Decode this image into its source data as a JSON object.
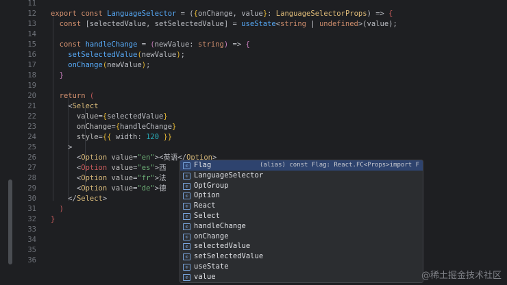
{
  "editor": {
    "lines": [
      {
        "n": "11",
        "tokens": []
      },
      {
        "n": "12",
        "tokens": [
          {
            "t": "export const ",
            "c": "kw"
          },
          {
            "t": "LanguageSelector",
            "c": "fn"
          },
          {
            "t": " = (",
            "c": "pl"
          },
          {
            "t": "{",
            "c": "br1"
          },
          {
            "t": "onChange",
            "c": "pl"
          },
          {
            "t": ", ",
            "c": "pl"
          },
          {
            "t": "value",
            "c": "pl"
          },
          {
            "t": "}",
            "c": "br1"
          },
          {
            "t": ": ",
            "c": "pl"
          },
          {
            "t": "LanguageSelectorProps",
            "c": "ty"
          },
          {
            "t": ") => ",
            "c": "pl"
          },
          {
            "t": "{",
            "c": "br2"
          }
        ]
      },
      {
        "n": "13",
        "tokens": [
          {
            "t": "  const ",
            "c": "kw"
          },
          {
            "t": "[selectedValue, setSelectedValue]",
            "c": "pl"
          },
          {
            "t": " = ",
            "c": "pl"
          },
          {
            "t": "useState",
            "c": "fn"
          },
          {
            "t": "<",
            "c": "pl"
          },
          {
            "t": "string",
            "c": "kw"
          },
          {
            "t": " | ",
            "c": "pl"
          },
          {
            "t": "undefined",
            "c": "kw"
          },
          {
            "t": ">(value);",
            "c": "pl"
          }
        ]
      },
      {
        "n": "14",
        "tokens": []
      },
      {
        "n": "15",
        "tokens": [
          {
            "t": "  const ",
            "c": "kw"
          },
          {
            "t": "handleChange",
            "c": "fn"
          },
          {
            "t": " = ",
            "c": "pl"
          },
          {
            "t": "(",
            "c": "br3"
          },
          {
            "t": "newValue: ",
            "c": "pl"
          },
          {
            "t": "string",
            "c": "kw"
          },
          {
            "t": ")",
            "c": "br3"
          },
          {
            "t": " => ",
            "c": "pl"
          },
          {
            "t": "{",
            "c": "br3"
          }
        ]
      },
      {
        "n": "16",
        "tokens": [
          {
            "t": "    setSelectedValue",
            "c": "fn"
          },
          {
            "t": "(",
            "c": "br1"
          },
          {
            "t": "newValue",
            "c": "pl"
          },
          {
            "t": ")",
            "c": "br1"
          },
          {
            "t": ";",
            "c": "pl"
          }
        ]
      },
      {
        "n": "17",
        "tokens": [
          {
            "t": "    onChange",
            "c": "fn"
          },
          {
            "t": "(",
            "c": "br1"
          },
          {
            "t": "newValue",
            "c": "pl"
          },
          {
            "t": ")",
            "c": "br1"
          },
          {
            "t": ";",
            "c": "pl"
          }
        ]
      },
      {
        "n": "18",
        "tokens": [
          {
            "t": "  }",
            "c": "br3"
          }
        ]
      },
      {
        "n": "19",
        "tokens": []
      },
      {
        "n": "20",
        "tokens": [
          {
            "t": "  return ",
            "c": "kw"
          },
          {
            "t": "(",
            "c": "br2"
          }
        ]
      },
      {
        "n": "21",
        "tokens": [
          {
            "t": "    <",
            "c": "pl"
          },
          {
            "t": "Select",
            "c": "tag"
          }
        ]
      },
      {
        "n": "22",
        "tokens": [
          {
            "t": "      value",
            "c": "at"
          },
          {
            "t": "=",
            "c": "pl"
          },
          {
            "t": "{",
            "c": "br1"
          },
          {
            "t": "selectedValue",
            "c": "pl"
          },
          {
            "t": "}",
            "c": "br1"
          }
        ]
      },
      {
        "n": "23",
        "tokens": [
          {
            "t": "      onChange",
            "c": "at"
          },
          {
            "t": "=",
            "c": "pl"
          },
          {
            "t": "{",
            "c": "br1"
          },
          {
            "t": "handleChange",
            "c": "pl"
          },
          {
            "t": "}",
            "c": "br1"
          }
        ]
      },
      {
        "n": "24",
        "tokens": [
          {
            "t": "      style",
            "c": "at"
          },
          {
            "t": "=",
            "c": "pl"
          },
          {
            "t": "{{",
            "c": "br1"
          },
          {
            "t": " width: ",
            "c": "pl"
          },
          {
            "t": "120",
            "c": "num"
          },
          {
            "t": " ",
            "c": "pl"
          },
          {
            "t": "}}",
            "c": "br1"
          }
        ]
      },
      {
        "n": "25",
        "tokens": [
          {
            "t": "    >",
            "c": "pl"
          }
        ]
      },
      {
        "n": "26",
        "tokens": [
          {
            "t": "      <",
            "c": "pl"
          },
          {
            "t": "Option",
            "c": "tag"
          },
          {
            "t": " value",
            "c": "at"
          },
          {
            "t": "=",
            "c": "pl"
          },
          {
            "t": "\"en\"",
            "c": "st"
          },
          {
            "t": ">",
            "c": "pl"
          },
          {
            "t": "<英语</",
            "c": "pl"
          },
          {
            "t": "Option",
            "c": "tag"
          },
          {
            "t": ">",
            "c": "pl"
          }
        ]
      },
      {
        "n": "27",
        "tokens": [
          {
            "t": "      <",
            "c": "pl"
          },
          {
            "t": "Option",
            "c": "br2"
          },
          {
            "t": " value",
            "c": "at"
          },
          {
            "t": "=",
            "c": "pl"
          },
          {
            "t": "\"es\"",
            "c": "st"
          },
          {
            "t": ">西",
            "c": "pl"
          }
        ]
      },
      {
        "n": "28",
        "tokens": [
          {
            "t": "      <",
            "c": "pl"
          },
          {
            "t": "Option",
            "c": "tag"
          },
          {
            "t": " value",
            "c": "at"
          },
          {
            "t": "=",
            "c": "pl"
          },
          {
            "t": "\"fr\"",
            "c": "st"
          },
          {
            "t": ">法",
            "c": "pl"
          }
        ]
      },
      {
        "n": "29",
        "tokens": [
          {
            "t": "      <",
            "c": "pl"
          },
          {
            "t": "Option",
            "c": "tag"
          },
          {
            "t": " value",
            "c": "at"
          },
          {
            "t": "=",
            "c": "pl"
          },
          {
            "t": "\"de\"",
            "c": "st"
          },
          {
            "t": ">德",
            "c": "pl"
          }
        ]
      },
      {
        "n": "30",
        "tokens": [
          {
            "t": "    </",
            "c": "pl"
          },
          {
            "t": "Select",
            "c": "tag"
          },
          {
            "t": ">",
            "c": "pl"
          }
        ]
      },
      {
        "n": "31",
        "tokens": [
          {
            "t": "  )",
            "c": "br2"
          }
        ]
      },
      {
        "n": "32",
        "tokens": [
          {
            "t": "}",
            "c": "br2"
          }
        ]
      },
      {
        "n": "33",
        "tokens": []
      },
      {
        "n": "34",
        "tokens": []
      },
      {
        "n": "35",
        "tokens": []
      },
      {
        "n": "36",
        "tokens": []
      }
    ]
  },
  "completion": {
    "icon_glyph": "⊙",
    "items": [
      {
        "label": "Flag",
        "detail": "(alias) const Flag: React.FC<Props>import Fl…",
        "selected": true
      },
      {
        "label": "LanguageSelector",
        "detail": ""
      },
      {
        "label": "OptGroup",
        "detail": ""
      },
      {
        "label": "Option",
        "detail": ""
      },
      {
        "label": "React",
        "detail": ""
      },
      {
        "label": "Select",
        "detail": ""
      },
      {
        "label": "handleChange",
        "detail": ""
      },
      {
        "label": "onChange",
        "detail": ""
      },
      {
        "label": "selectedValue",
        "detail": ""
      },
      {
        "label": "setSelectedValue",
        "detail": ""
      },
      {
        "label": "useState",
        "detail": ""
      },
      {
        "label": "value",
        "detail": ""
      }
    ]
  },
  "watermark": "@稀土掘金技术社区"
}
